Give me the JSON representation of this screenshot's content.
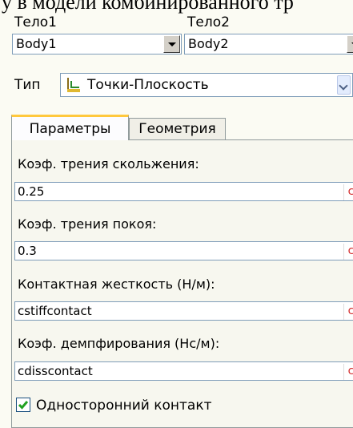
{
  "cutoff_line": "у в модели комбинированного тр",
  "body1": {
    "label": "Тело1",
    "value": "Body1"
  },
  "body2": {
    "label": "Тело2",
    "value": "Body2"
  },
  "type": {
    "label": "Тип",
    "value": "Точки-Плоскость",
    "icon": "point-plane-icon"
  },
  "tabs": [
    {
      "label": "Параметры",
      "active": true
    },
    {
      "label": "Геометрия",
      "active": false
    }
  ],
  "fields": [
    {
      "label": "Коэф. трения скольжения:",
      "value": "0.25",
      "button": "c"
    },
    {
      "label": "Коэф. трения покоя:",
      "value": "0.3",
      "button": "c"
    },
    {
      "label": "Контактная жесткость (Н/м):",
      "value": "cstiffcontact",
      "button": "c"
    },
    {
      "label": "Коэф. демпфирования (Нс/м):",
      "value": "cdisscontact",
      "button": "c"
    }
  ],
  "one_sided": {
    "label": "Односторонний контакт",
    "checked": true
  },
  "colors": {
    "background": "#fbfbf3",
    "tab_highlight": "#ffc83c",
    "c_button": "#d42c2c",
    "check": "#21a121"
  }
}
